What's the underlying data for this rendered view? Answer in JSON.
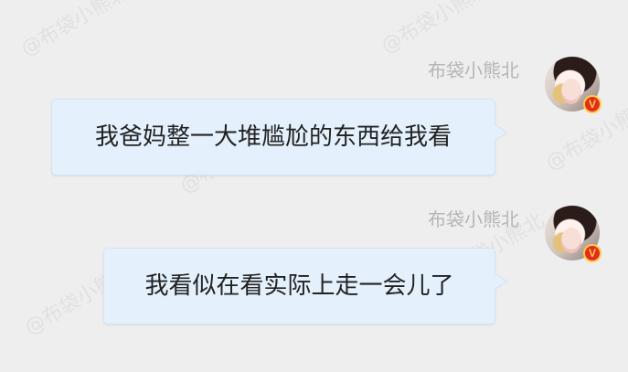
{
  "watermark": "@布袋小熊北",
  "messages": [
    {
      "sender": "布袋小熊北",
      "text": "我爸妈整一大堆尴尬的东西给我看",
      "verified": "V"
    },
    {
      "sender": "布袋小熊北",
      "text": "我看似在看实际上走一会儿了",
      "verified": "V"
    }
  ]
}
